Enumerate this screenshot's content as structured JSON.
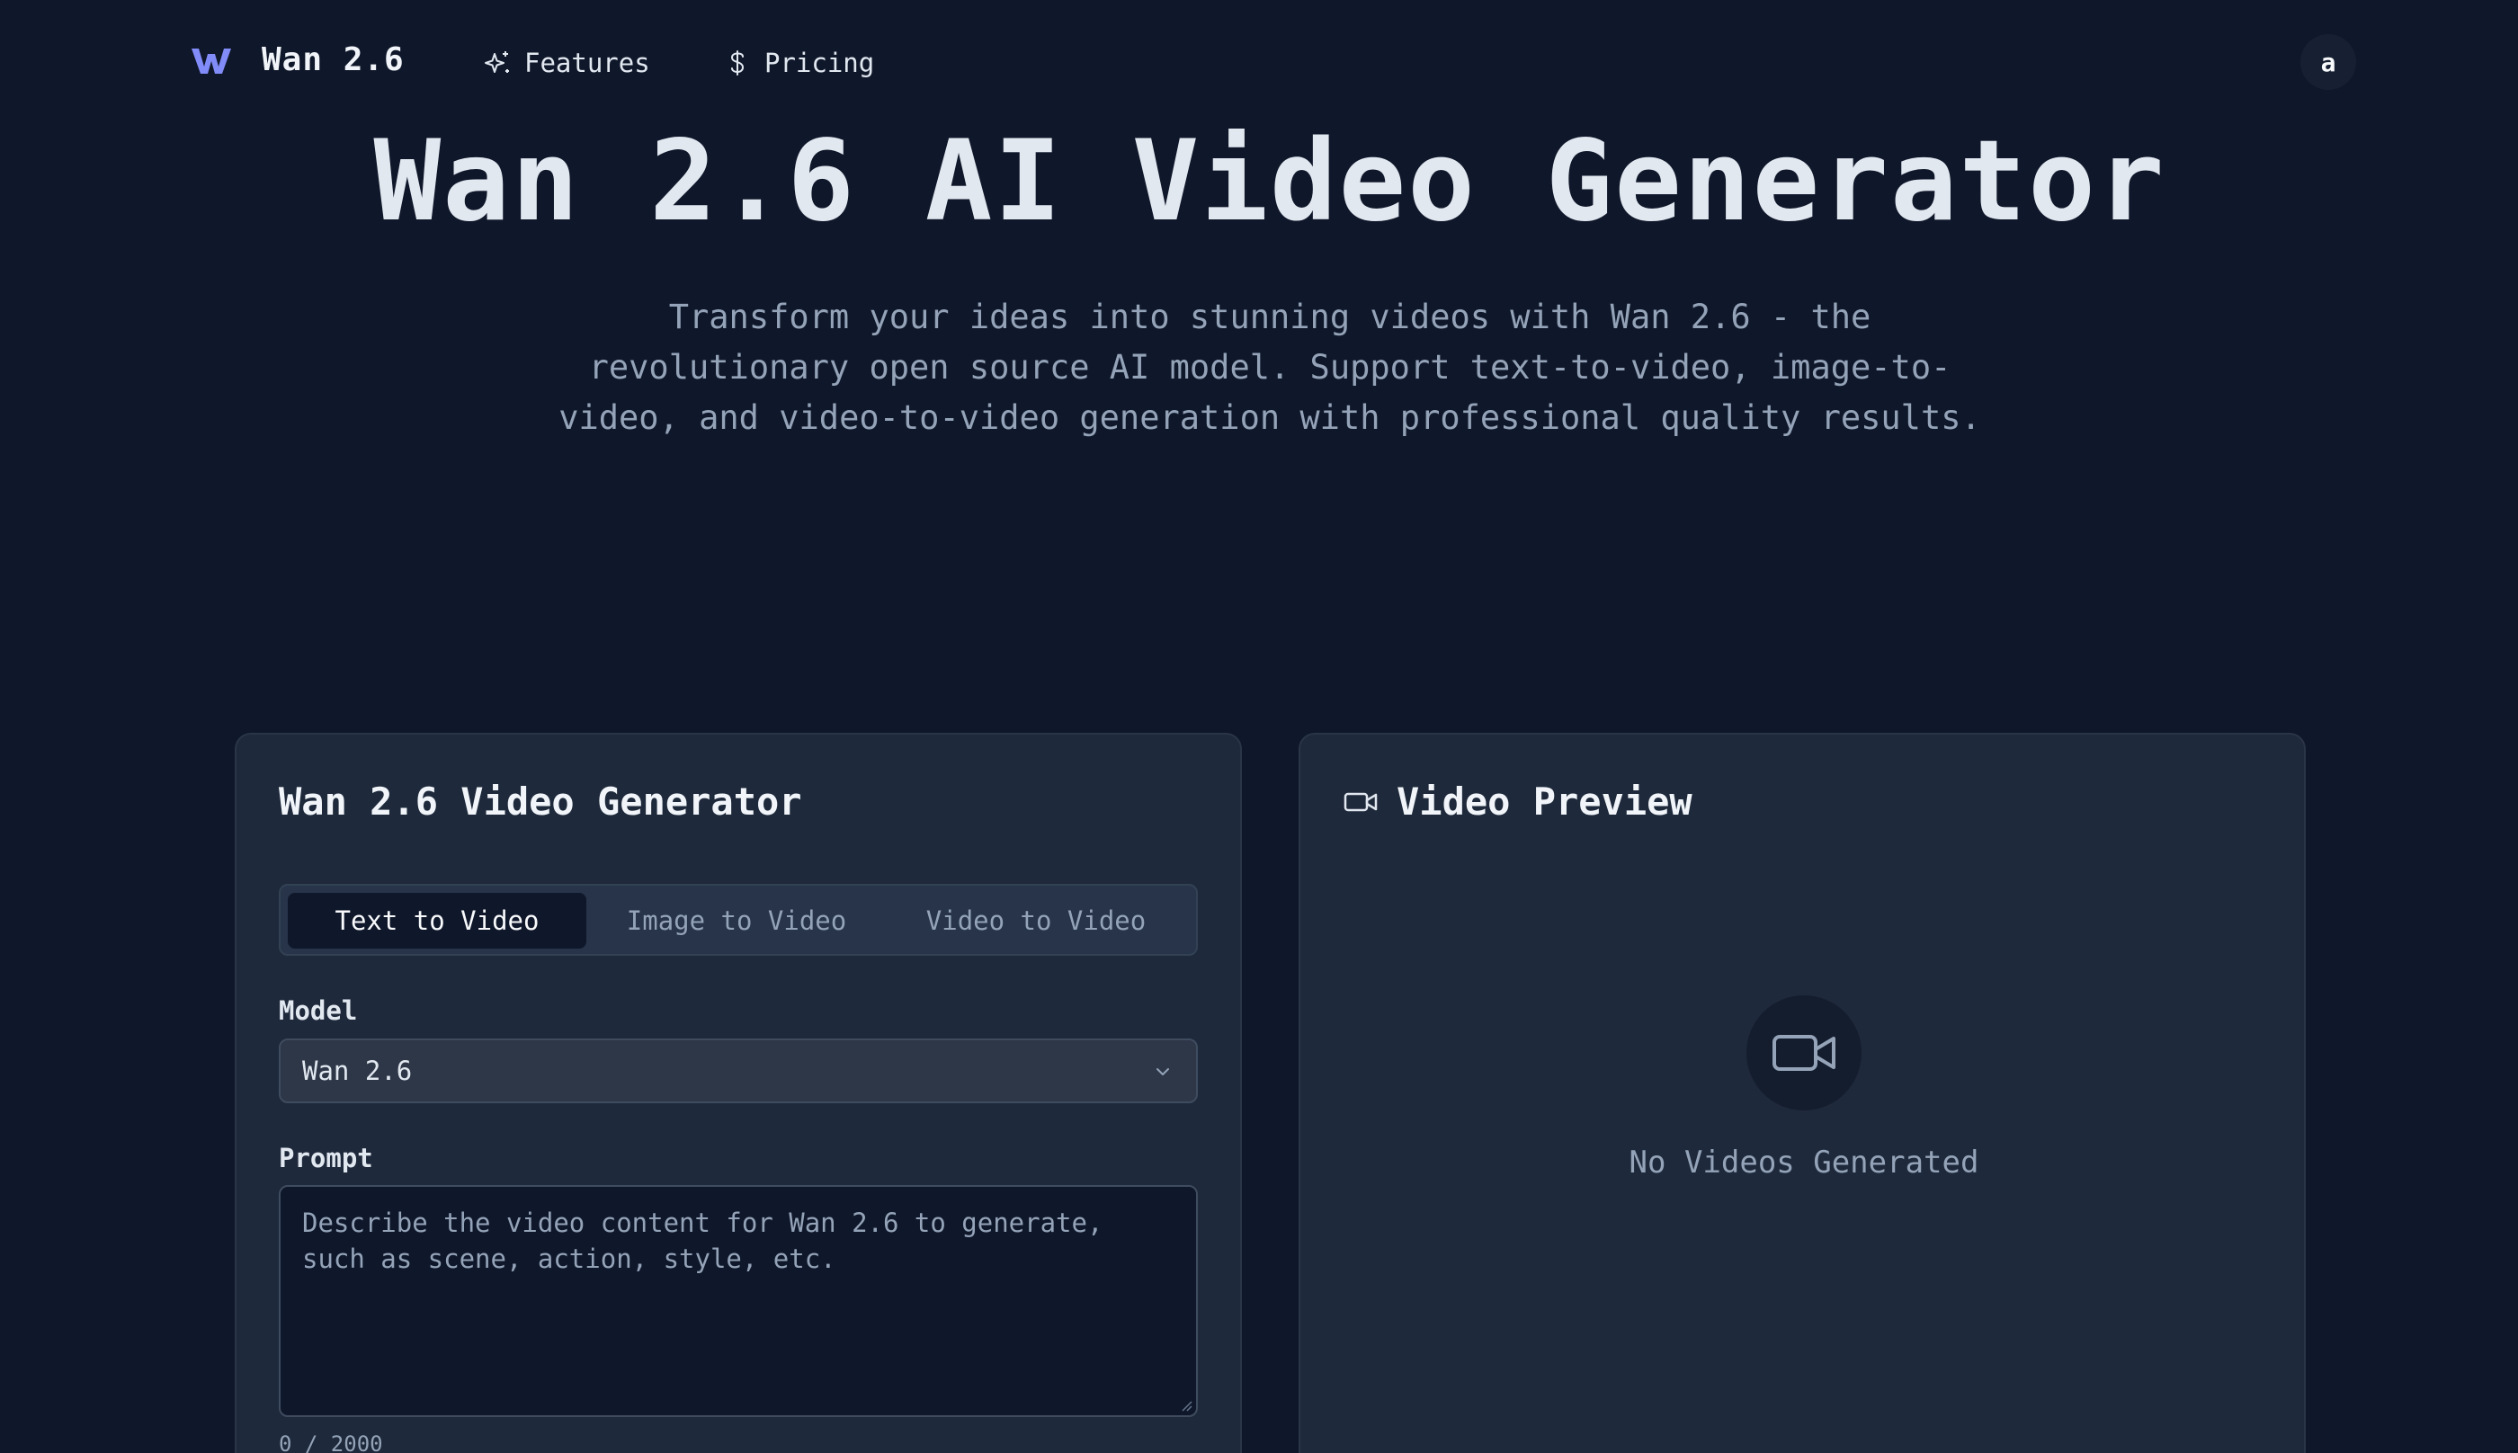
{
  "nav": {
    "brand": "Wan 2.6",
    "logo_icon": "w-logo-icon",
    "links": [
      {
        "label": "Features",
        "icon": "sparkles-icon"
      },
      {
        "label": "Pricing",
        "icon": "dollar-icon"
      }
    ],
    "avatar_initial": "a"
  },
  "hero": {
    "title": "Wan 2.6 AI Video Generator",
    "subtitle": "Transform your ideas into stunning videos with Wan 2.6 - the revolutionary open source AI model. Support text-to-video, image-to-video, and video-to-video generation with professional quality results."
  },
  "generator": {
    "title": "Wan 2.6 Video Generator",
    "tabs": [
      {
        "label": "Text to Video",
        "active": true
      },
      {
        "label": "Image to Video",
        "active": false
      },
      {
        "label": "Video to Video",
        "active": false
      }
    ],
    "model_label": "Model",
    "model_value": "Wan 2.6",
    "prompt_label": "Prompt",
    "prompt_placeholder": "Describe the video content for Wan 2.6 to generate, such as scene, action, style, etc.",
    "prompt_value": "",
    "char_count": "0 / 2000"
  },
  "preview": {
    "title": "Video Preview",
    "icon": "video-camera-icon",
    "empty_text": "No Videos Generated"
  },
  "colors": {
    "background": "#0f172a",
    "panel": "#1e293b",
    "accent": "#818cf8",
    "muted_text": "#94a3b8"
  }
}
